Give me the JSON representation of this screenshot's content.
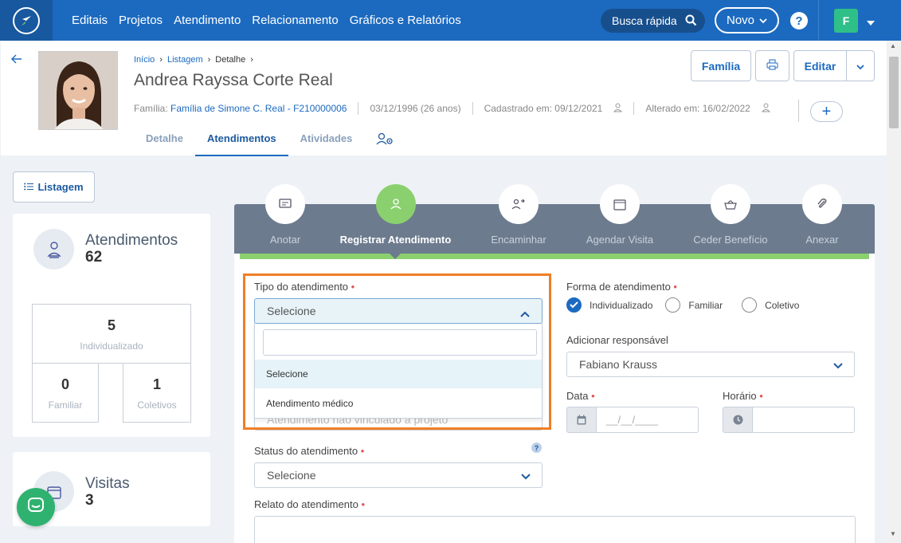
{
  "nav": {
    "links": [
      "Editais",
      "Projetos",
      "Atendimento",
      "Relacionamento",
      "Gráficos e Relatórios"
    ],
    "search_label": "Busca rápida",
    "novo_label": "Novo",
    "help_label": "?",
    "user_initial": "F"
  },
  "breadcrumb": {
    "home": "Início",
    "list": "Listagem",
    "current": "Detalhe"
  },
  "person": {
    "name": "Andrea Rayssa Corte Real",
    "family_prefix": "Família:",
    "family_link": "Família de Simone C. Real - F210000006",
    "birth": "03/12/1996 (26 anos)",
    "registered": "Cadastrado em: 09/12/2021",
    "updated": "Alterado em: 16/02/2022"
  },
  "header_buttons": {
    "familia": "Família",
    "editar": "Editar",
    "plus": "+"
  },
  "tabs": [
    "Detalhe",
    "Atendimentos",
    "Atividades"
  ],
  "left": {
    "listagem": "Listagem",
    "atendimentos_title": "Atendimentos",
    "atendimentos_count": "62",
    "individualizado_count": "5",
    "individualizado_label": "Individualizado",
    "familiar_count": "0",
    "familiar_label": "Familiar",
    "coletivos_count": "1",
    "coletivos_label": "Coletivos",
    "visitas_title": "Visitas",
    "visitas_count": "3"
  },
  "actions": [
    "Anotar",
    "Registrar Atendimento",
    "Encaminhar",
    "Agendar Visita",
    "Ceder Benefício",
    "Anexar"
  ],
  "form": {
    "tipo_label": "Tipo do atendimento",
    "tipo_value": "Selecione",
    "dropdown_options": [
      "Selecione",
      "Atendimento médico"
    ],
    "hidden_field_value": "Atendimento não vinculado a projeto",
    "status_label": "Status do atendimento",
    "status_value": "Selecione",
    "relato_label": "Relato do atendimento",
    "forma_label": "Forma de atendimento",
    "forma_options": [
      "Individualizado",
      "Familiar",
      "Coletivo"
    ],
    "responsavel_label": "Adicionar responsável",
    "responsavel_value": "Fabiano Krauss",
    "data_label": "Data",
    "data_placeholder": "__/__/____",
    "horario_label": "Horário",
    "help": "?"
  },
  "colors": {
    "nav": "#1c6ac0",
    "accent_green": "#8bd06f",
    "highlight": "#f07e26"
  }
}
